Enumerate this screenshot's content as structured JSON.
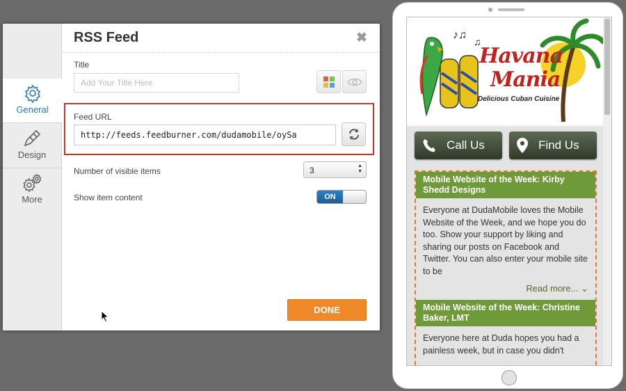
{
  "dialog": {
    "title": "RSS Feed",
    "close_glyph": "✖",
    "sidebar": [
      {
        "label": "General",
        "icon": "gear-icon",
        "active": true
      },
      {
        "label": "Design",
        "icon": "brush-icon",
        "active": false
      },
      {
        "label": "More",
        "icon": "gears-icon",
        "active": false
      }
    ],
    "title_field": {
      "label": "Title",
      "placeholder": "Add Your Title Here",
      "value": ""
    },
    "feed_url": {
      "label": "Feed URL",
      "value": "http://feeds.feedburner.com/dudamobile/oySa"
    },
    "visible_items": {
      "label": "Number of visible items",
      "value": "3"
    },
    "show_content": {
      "label": "Show item content",
      "state": "ON"
    },
    "done_label": "DONE",
    "colors": {
      "accent": "#f0892a",
      "highlight": "#c4352a",
      "toggle": "#2f7fc0"
    }
  },
  "phone": {
    "logo": {
      "line1": "Havana",
      "line2": "Mania",
      "tagline": "Delicious Cuban Cuisine"
    },
    "buttons": [
      {
        "label": "Call Us",
        "icon": "phone-icon"
      },
      {
        "label": "Find Us",
        "icon": "map-pin-icon"
      }
    ],
    "feed_items": [
      {
        "title": "Mobile Website of the Week: Kirby Shedd Designs",
        "body": "Everyone at DudaMobile loves the Mobile Website of the Week, and we hope you do too. Show your support by liking and sharing our posts on Facebook and Twitter. You can also enter your mobile site to be",
        "read_more": "Read more..."
      },
      {
        "title": "Mobile Website of the Week: Christine Baker, LMT",
        "body": "Everyone here at Duda hopes you had a painless week, but in case you didn't"
      }
    ],
    "colors": {
      "feed_header": "#6e9a3a",
      "feed_border": "#e5772a"
    }
  }
}
